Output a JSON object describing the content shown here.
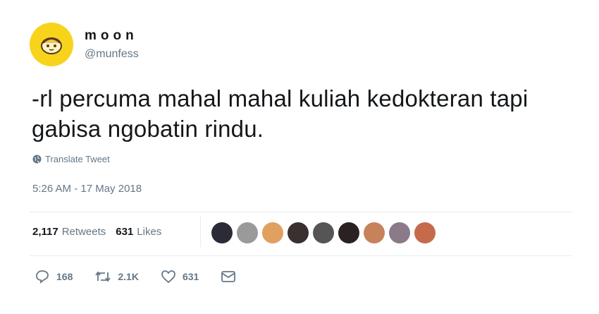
{
  "user": {
    "display_name": "moon",
    "handle": "@munfess",
    "avatar_icon": "egg-avatar-icon"
  },
  "tweet": {
    "text": "-rl percuma mahal mahal kuliah kedokteran tapi gabisa ngobatin rindu.",
    "translate_label": "Translate Tweet",
    "timestamp": "5:26 AM - 17 May 2018"
  },
  "stats": {
    "retweets_count": "2,117",
    "retweets_label": "Retweets",
    "likes_count": "631",
    "likes_label": "Likes"
  },
  "likers": [
    {
      "color": "#2b2b38"
    },
    {
      "color": "#9a9a9a"
    },
    {
      "color": "#e0a060"
    },
    {
      "color": "#3a3030"
    },
    {
      "color": "#555555"
    },
    {
      "color": "#2a2220"
    },
    {
      "color": "#c8825a"
    },
    {
      "color": "#8a7a8a"
    },
    {
      "color": "#c56a4a"
    }
  ],
  "actions": {
    "replies": "168",
    "retweets": "2.1K",
    "likes": "631"
  }
}
